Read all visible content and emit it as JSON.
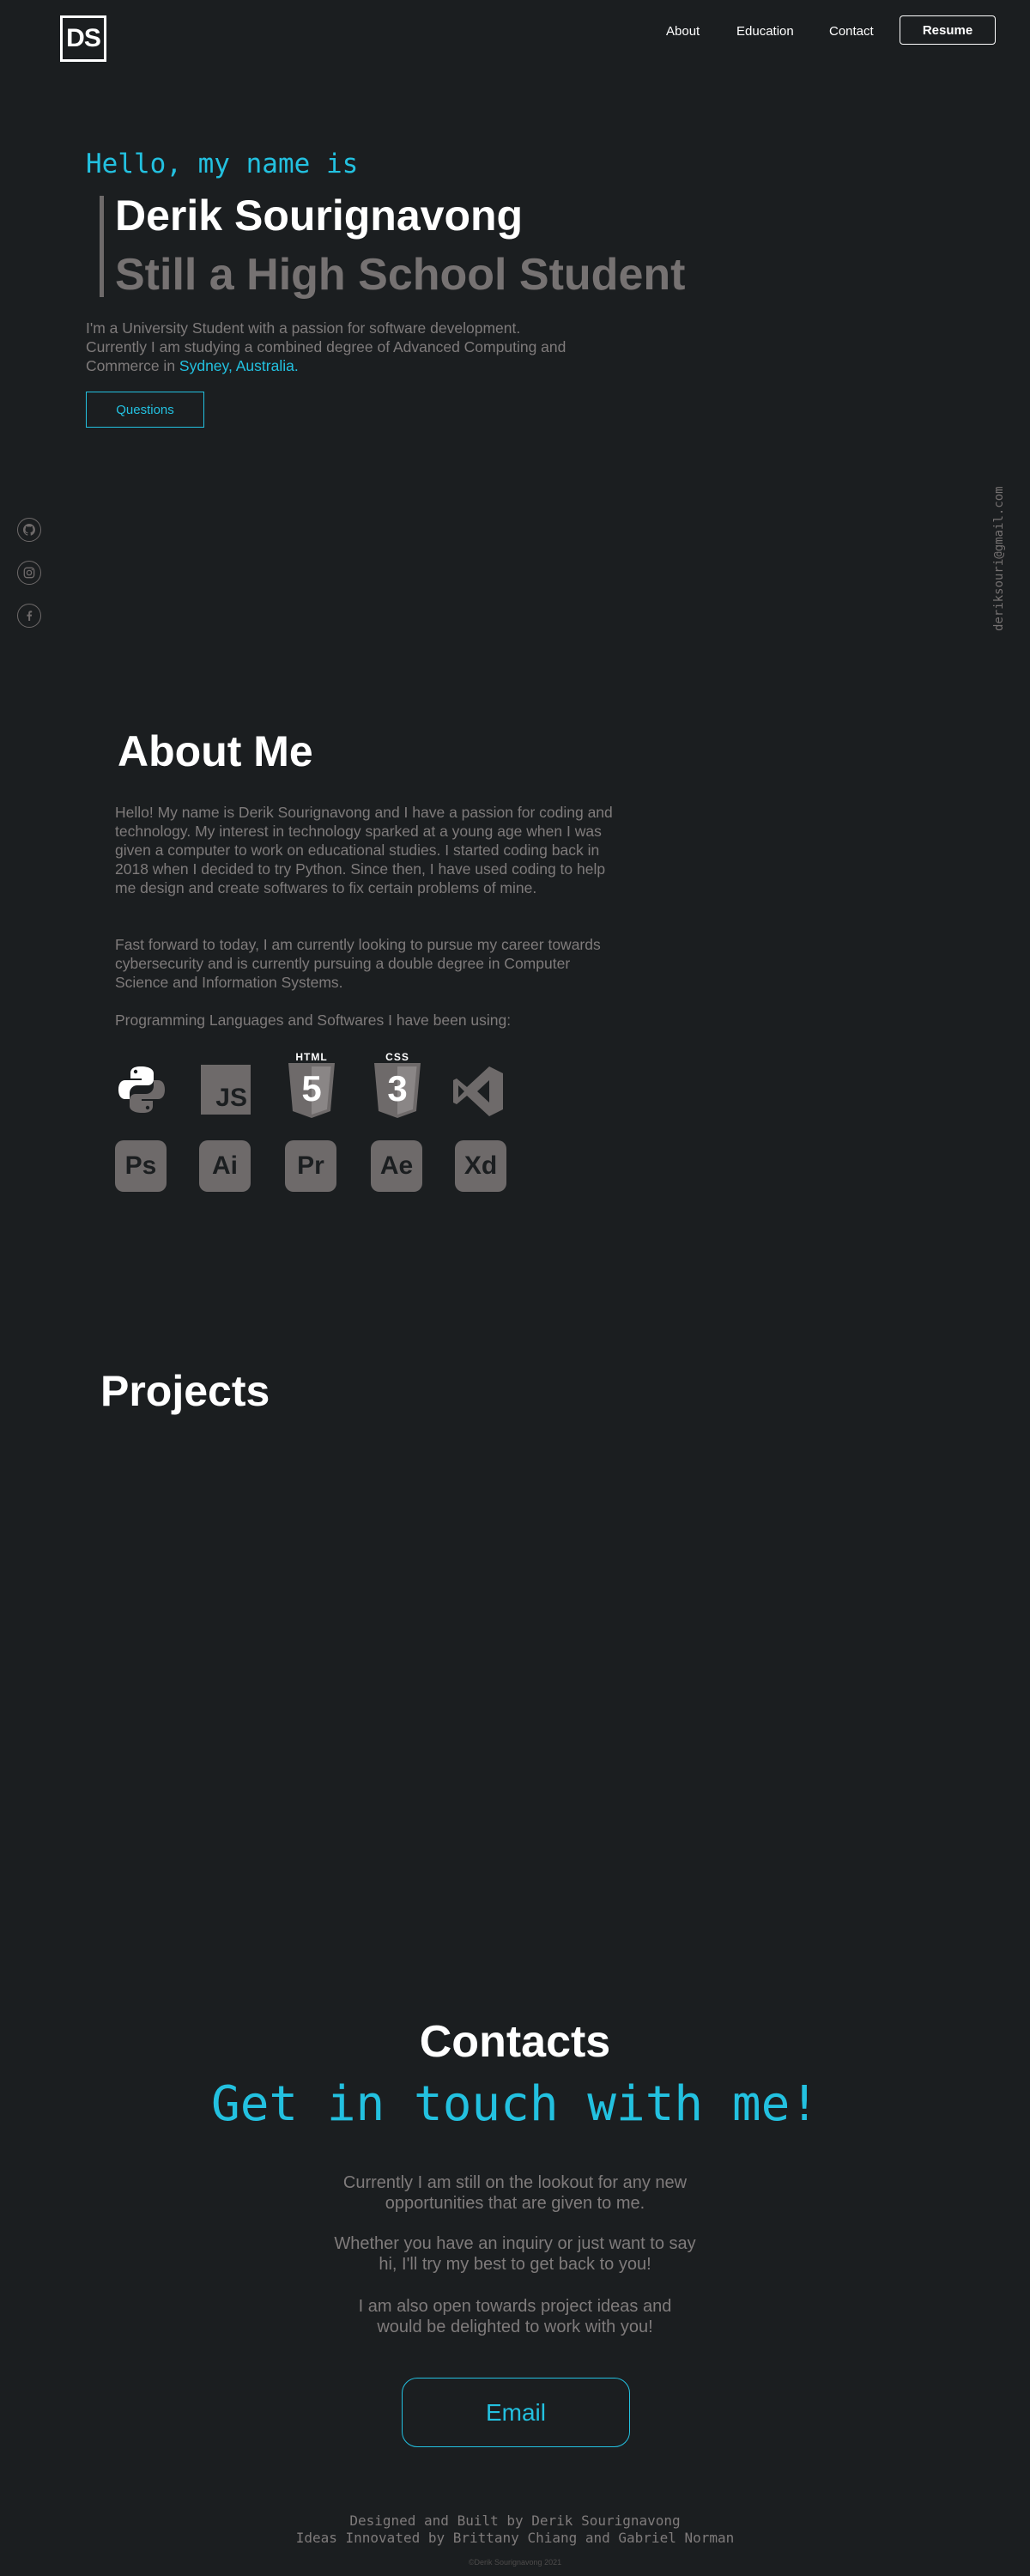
{
  "nav": {
    "logo": "DS",
    "links": [
      "About",
      "Education",
      "Contact"
    ],
    "resume_label": "Resume"
  },
  "hero": {
    "greeting": "Hello, my name is",
    "name": "Derik Sourignavong",
    "tagline": "Still a High School Student",
    "desc_line1": "I'm a University Student with a passion for software development.",
    "desc_line2": "Currently I am studying a combined degree of Advanced Computing and",
    "desc_line3_prefix": "Commerce in ",
    "desc_location": "Sydney, Australia.",
    "button_label": "Questions"
  },
  "social": {
    "icons": [
      "github-icon",
      "instagram-icon",
      "facebook-icon"
    ],
    "email": "deriksouri@gmail.com"
  },
  "about": {
    "title": "About Me",
    "para1": "Hello! My name is Derik Sourignavong and I have a passion for coding and technology. My interest in technology sparked at a young age when I was given a computer to work on educational studies. I started coding back in 2018 when I decided to try Python. Since then, I have used coding to help me design and create softwares to fix certain problems of mine.",
    "para2": "Fast forward to today, I am currently looking to pursue my career towards cybersecurity and is currently pursuing a double degree in Computer Science and Information Systems.",
    "skills_heading": "Programming Languages and Softwares I have been using:",
    "skills_row1": [
      {
        "name": "python-icon"
      },
      {
        "name": "javascript-icon",
        "label": "JS"
      },
      {
        "name": "html5-icon",
        "label": "HTML",
        "num": "5"
      },
      {
        "name": "css3-icon",
        "label": "CSS",
        "num": "3"
      },
      {
        "name": "visual-studio-icon"
      }
    ],
    "skills_row2": [
      {
        "name": "photoshop-icon",
        "label": "Ps"
      },
      {
        "name": "illustrator-icon",
        "label": "Ai"
      },
      {
        "name": "premiere-icon",
        "label": "Pr"
      },
      {
        "name": "after-effects-icon",
        "label": "Ae"
      },
      {
        "name": "xd-icon",
        "label": "Xd"
      }
    ]
  },
  "projects": {
    "title": "Projects"
  },
  "contacts": {
    "title": "Contacts",
    "subtitle": "Get in touch with me!",
    "p1_line1": "Currently I am still on the lookout for any new",
    "p1_line2": "opportunities that are given to me.",
    "p2_line1": "Whether you have an inquiry or just want to say",
    "p2_line2": "hi, I'll try my best to get back to you!",
    "p3_line1": "I am also open towards project ideas and",
    "p3_line2": "would be delighted to work with you!",
    "button_label": "Email"
  },
  "footer": {
    "line1": "Designed and Built by Derik Sourignavong",
    "line2": "Ideas Innovated by Brittany Chiang and Gabriel Norman",
    "copyright": "©Derik Sourignavong 2021"
  },
  "colors": {
    "accent": "#23c1e0",
    "background": "#1b1e20",
    "muted": "#7f7b7b",
    "icon": "#6e6a6a"
  }
}
